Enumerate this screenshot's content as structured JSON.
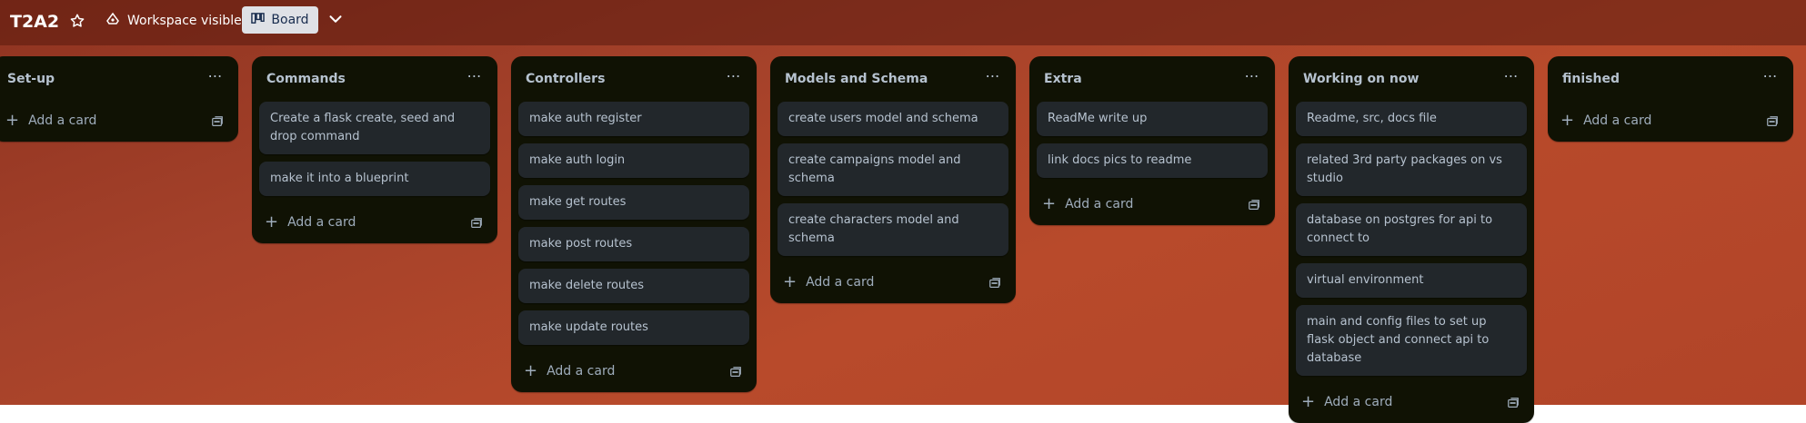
{
  "header": {
    "board_title": "T2A2",
    "visibility_label": "Workspace visible",
    "view_label": "Board"
  },
  "colors": {
    "board_background": "#a4412a",
    "list_background": "#101204",
    "card_background": "#22272b",
    "text": "#b6c2cf"
  },
  "icons": [
    "star-icon",
    "workspace-visible-icon",
    "board-view-icon",
    "chevron-down-icon",
    "more-icon",
    "plus-icon",
    "card-template-icon"
  ],
  "add_card_label": "Add a card",
  "lists": [
    {
      "title": "Set-up",
      "cards": []
    },
    {
      "title": "Commands",
      "cards": [
        "Create a flask create, seed and drop command",
        "make it into a blueprint"
      ]
    },
    {
      "title": "Controllers",
      "cards": [
        "make auth register",
        "make auth login",
        "make get routes",
        "make post routes",
        "make delete routes",
        "make update routes"
      ]
    },
    {
      "title": "Models and Schema",
      "cards": [
        "create users model and schema",
        "create campaigns model and schema",
        "create characters model and schema"
      ]
    },
    {
      "title": "Extra",
      "cards": [
        "ReadMe write up",
        "link docs pics to readme"
      ]
    },
    {
      "title": "Working on now",
      "cards": [
        "Readme, src, docs file",
        "related 3rd party packages on vs studio",
        "database on postgres for api to connect to",
        "virtual environment",
        "main and config files to set up flask object and connect api to database"
      ]
    },
    {
      "title": "finished",
      "cards": []
    }
  ]
}
